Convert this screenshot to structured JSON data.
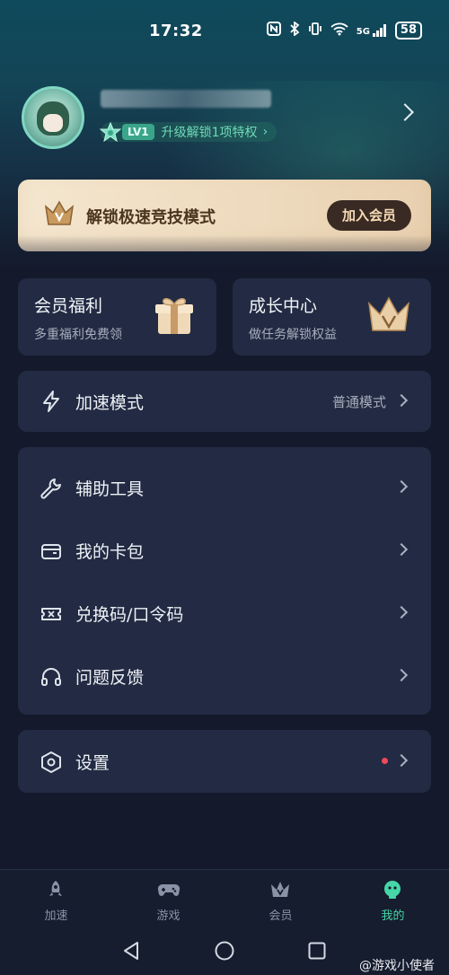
{
  "status_bar": {
    "time": "17:32",
    "signal": "5G",
    "battery": "58"
  },
  "profile": {
    "level": "LV1",
    "level_prompt": "升级解锁1项特权",
    "level_chevron": "›"
  },
  "vip_banner": {
    "title": "解锁极速竞技模式",
    "join_label": "加入会员"
  },
  "cards": [
    {
      "title": "会员福利",
      "subtitle": "多重福利免费领"
    },
    {
      "title": "成长中心",
      "subtitle": "做任务解锁权益"
    }
  ],
  "speed_mode": {
    "label": "加速模式",
    "value": "普通模式"
  },
  "menu": [
    {
      "label": "辅助工具",
      "icon": "wrench-icon"
    },
    {
      "label": "我的卡包",
      "icon": "wallet-icon"
    },
    {
      "label": "兑换码/口令码",
      "icon": "ticket-icon"
    },
    {
      "label": "问题反馈",
      "icon": "headset-icon"
    }
  ],
  "settings": {
    "label": "设置",
    "icon": "hexagon-gear-icon"
  },
  "tabs": [
    {
      "label": "加速",
      "icon": "rocket-icon",
      "active": false
    },
    {
      "label": "游戏",
      "icon": "gamepad-icon",
      "active": false
    },
    {
      "label": "会员",
      "icon": "crown-icon",
      "active": false
    },
    {
      "label": "我的",
      "icon": "robot-face-icon",
      "active": true
    }
  ],
  "watermark": "@游戏小使者",
  "colors": {
    "accent": "#46d6a7",
    "background": "#141a2c",
    "card": "#222b43",
    "banner_gold": "#f4e6cf"
  }
}
